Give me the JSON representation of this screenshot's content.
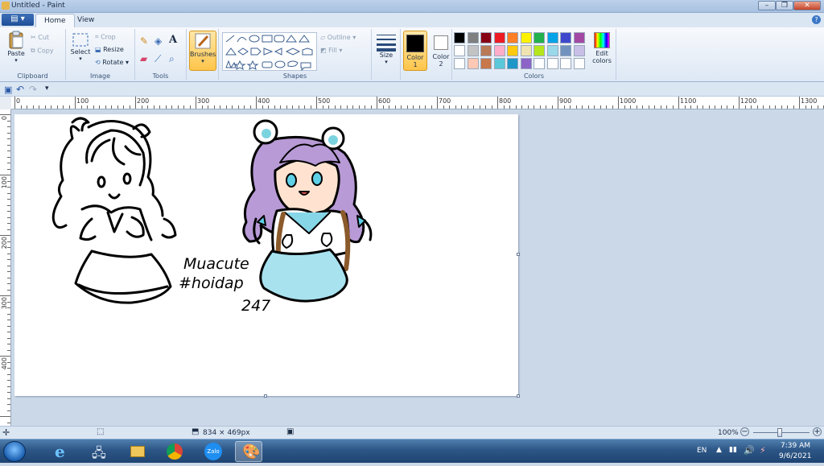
{
  "window": {
    "title": "Untitled - Paint",
    "controls": [
      "minimize",
      "restore",
      "close"
    ]
  },
  "menu": {
    "file_button": "▤ ▾",
    "tabs": [
      "Home",
      "View"
    ]
  },
  "ribbon": {
    "clipboard": {
      "label": "Clipboard",
      "paste": "Paste",
      "cut": "Cut",
      "copy": "Copy"
    },
    "image": {
      "label": "Image",
      "select": "Select",
      "crop": "Crop",
      "resize": "Resize",
      "rotate": "Rotate"
    },
    "tools": {
      "label": "Tools"
    },
    "brushes": {
      "label": "Brushes"
    },
    "shapes": {
      "label": "Shapes",
      "outline": "Outline",
      "fill": "Fill"
    },
    "size": {
      "label": "Size"
    },
    "color1": {
      "label": "Color",
      "index": "1",
      "value": "#000000"
    },
    "color2": {
      "label": "Color",
      "index": "2",
      "value": "#ffffff"
    },
    "colors": {
      "label": "Colors",
      "edit": "Edit colors",
      "palette_row1": [
        "#000000",
        "#7f7f7f",
        "#880015",
        "#ed1c24",
        "#ff7f27",
        "#fff200",
        "#22b14c",
        "#00a2e8",
        "#3f48cc",
        "#a349a4"
      ],
      "palette_row2": [
        "#ffffff",
        "#c3c3c3",
        "#b97a57",
        "#ffaec9",
        "#ffc90e",
        "#efe4b0",
        "#b5e61d",
        "#99d9ea",
        "#7092be",
        "#c8bfe7"
      ],
      "palette_row3": [
        "#ffffff",
        "#ffc8b4",
        "#c8784a",
        "#5ac8d8",
        "#1e96c8",
        "#8c64c8",
        "#ffffff",
        "#ffffff",
        "#ffffff",
        "#ffffff"
      ]
    }
  },
  "rulers": {
    "horizontal": [
      "0",
      "100",
      "200",
      "300",
      "400",
      "500",
      "600",
      "700",
      "800",
      "900",
      "1000",
      "1100",
      "1200",
      "1300"
    ],
    "vertical": [
      "0",
      "100",
      "200",
      "300",
      "400"
    ]
  },
  "drawing": {
    "signature_line1": "Muacute",
    "signature_line2": "#hoidap",
    "signature_line3": "247"
  },
  "status": {
    "image_size": "834 × 469px",
    "zoom": "100%"
  },
  "taskbar": {
    "apps": [
      "internet-explorer",
      "network",
      "file-explorer",
      "chrome",
      "zalo",
      "paint"
    ],
    "zalo_label": "Zalo",
    "language": "EN",
    "time": "7:39 AM",
    "date": "9/6/2021"
  }
}
